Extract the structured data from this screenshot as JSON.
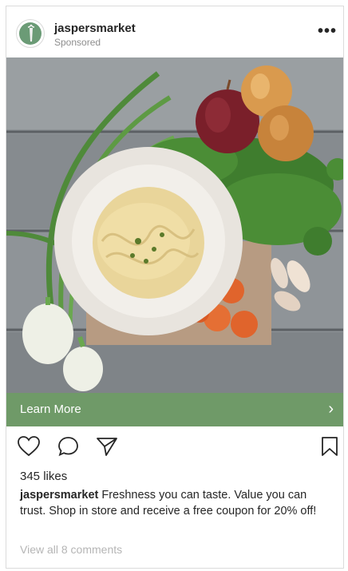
{
  "post": {
    "username": "jaspersmarket",
    "sponsored": "Sponsored",
    "more": "•••",
    "cta_label": "Learn More",
    "cta_arrow": "›",
    "likes": "345 likes",
    "caption_user": "jaspersmarket",
    "caption_text": "Freshness you can taste. Value you can trust. Shop in store and receive a free coupon for 20% off!",
    "view_comments": "View all 8 comments"
  },
  "colors": {
    "cta": "#6f9a68",
    "text": "#262626",
    "muted": "#8e8e8e"
  },
  "icons": [
    "heart-icon",
    "comment-icon",
    "share-icon",
    "bookmark-icon"
  ]
}
